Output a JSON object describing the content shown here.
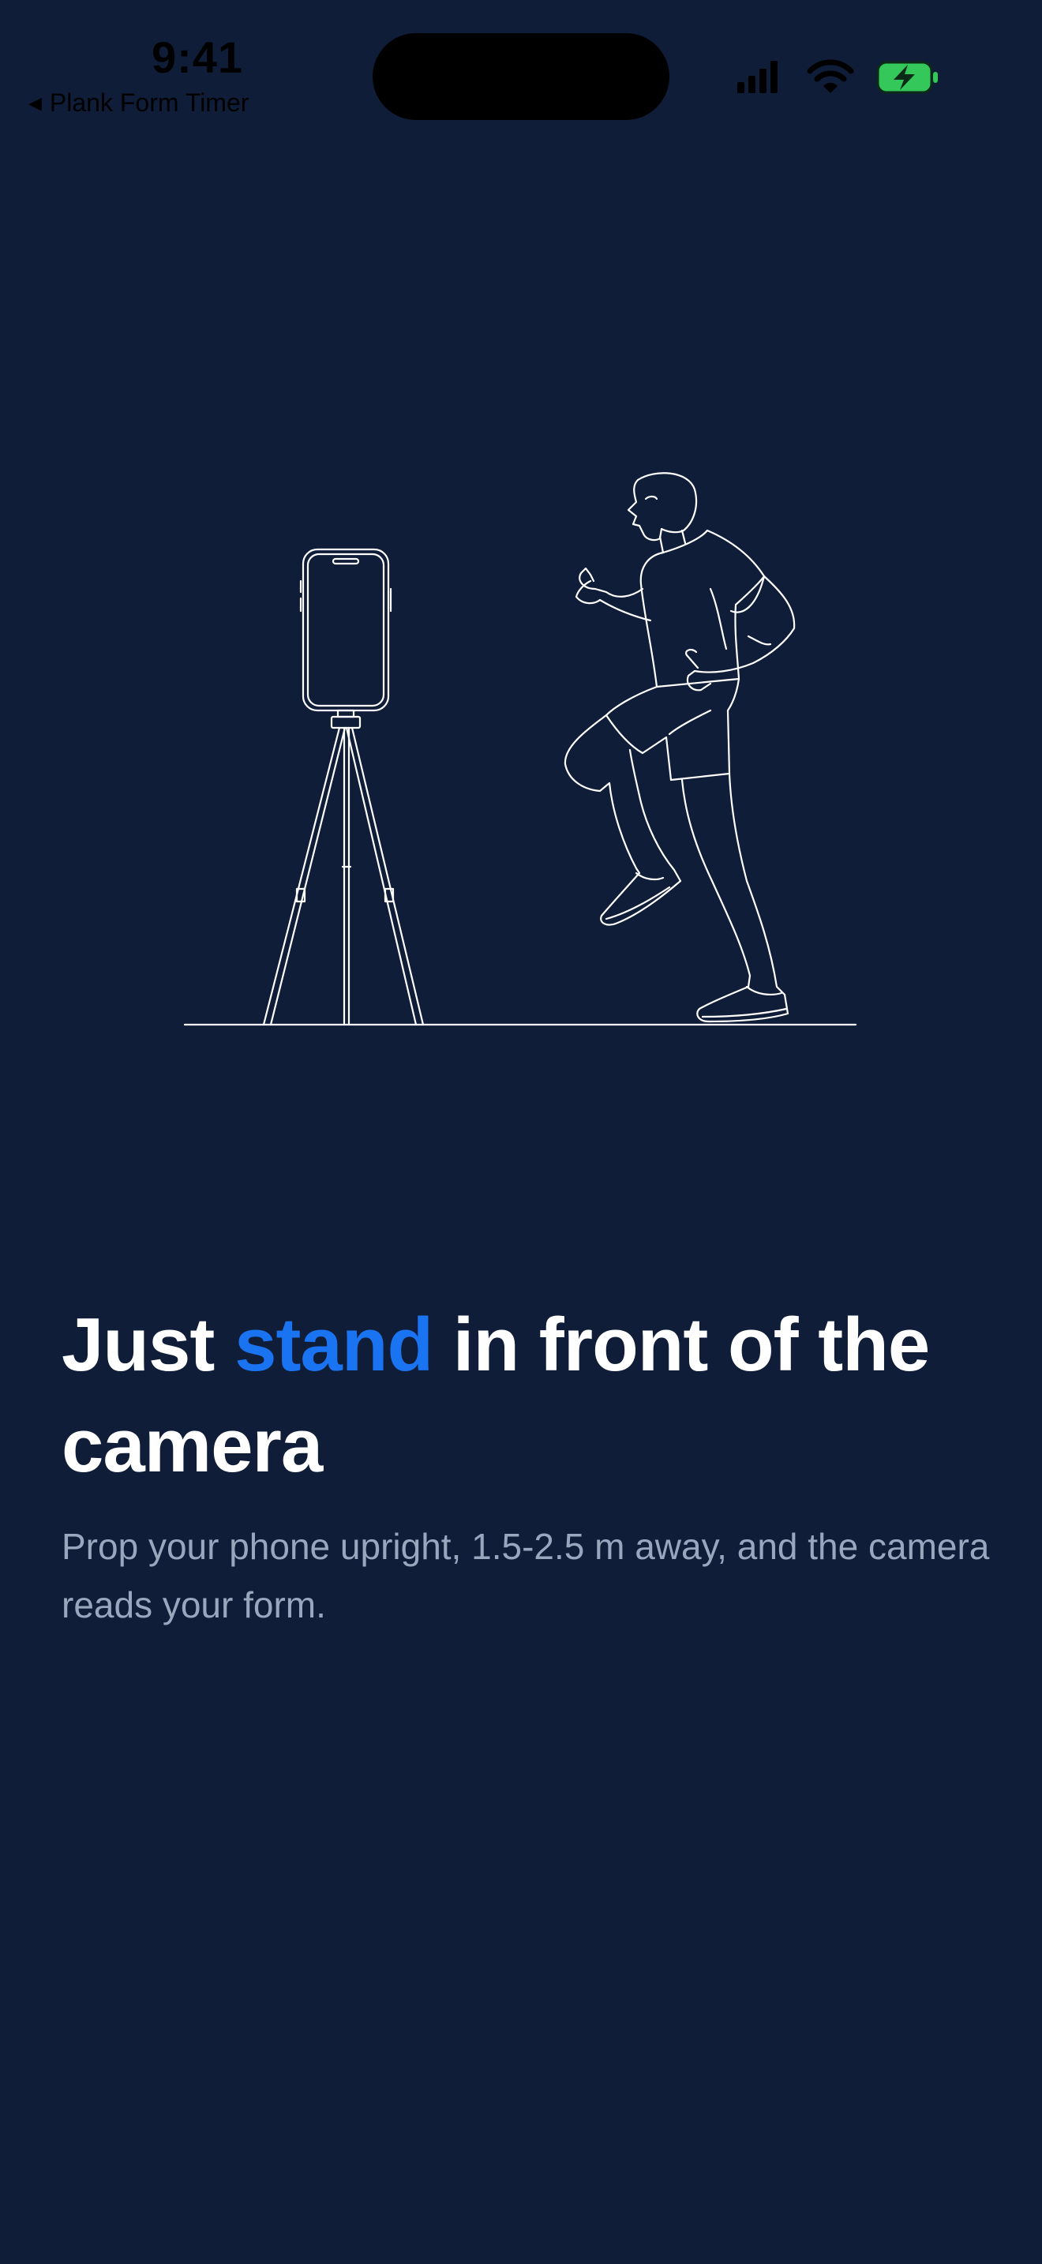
{
  "status_bar": {
    "time": "9:41",
    "back_app_label": "Plank Form Timer",
    "icons": [
      "cellular-signal-icon",
      "wifi-icon",
      "battery-charging-icon"
    ],
    "battery_color": "#34c759"
  },
  "onboarding": {
    "headline_prefix": "Just",
    "headline_accent": "stand",
    "headline_suffix": "in front of the camera",
    "subtext": "Prop your phone upright, 1.5-2.5 m away, and the camera reads your form."
  },
  "illustration": {
    "icons": [
      "phone-on-tripod-icon",
      "running-person-icon"
    ]
  },
  "colors": {
    "background": "#0f1d38",
    "accent": "#1a73f0",
    "headline": "#ffffff",
    "subtext": "#9aa6bd",
    "line_art": "#ffffff"
  }
}
